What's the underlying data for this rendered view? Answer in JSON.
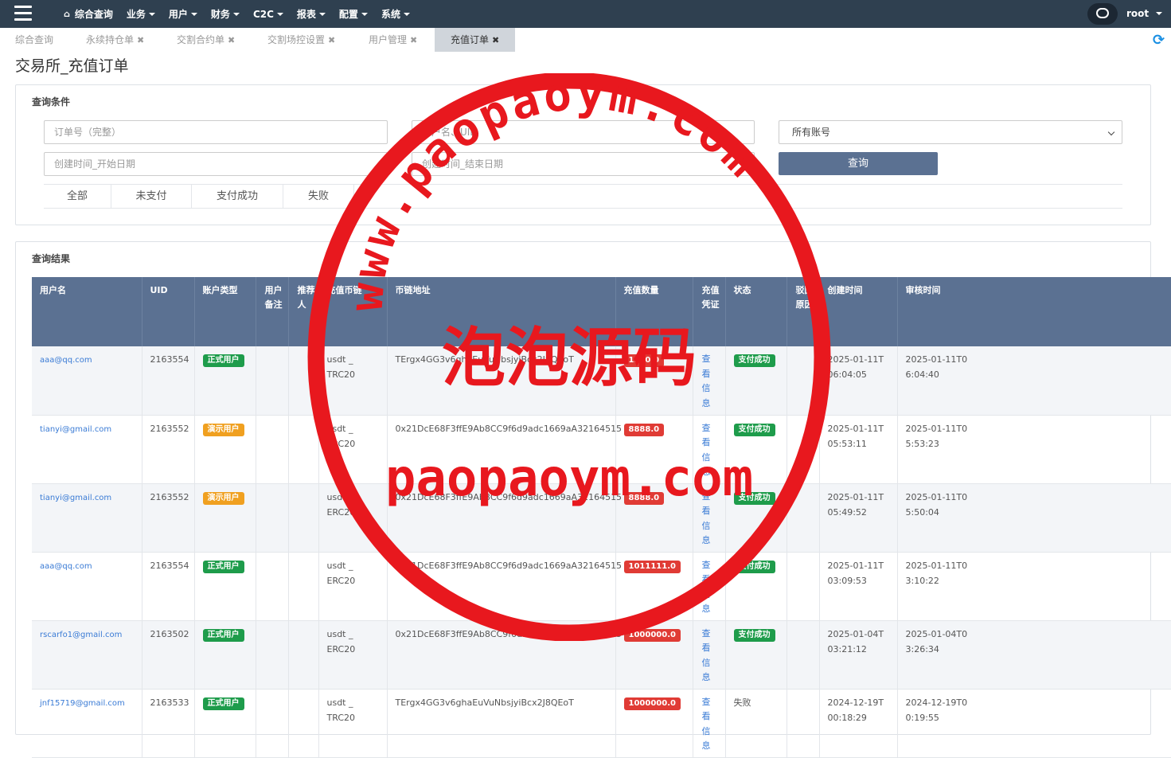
{
  "topbar": {
    "nav": [
      {
        "label": "综合查询",
        "caret": false
      },
      {
        "label": "业务",
        "caret": true
      },
      {
        "label": "用户",
        "caret": true
      },
      {
        "label": "财务",
        "caret": true
      },
      {
        "label": "C2C",
        "caret": true
      },
      {
        "label": "报表",
        "caret": true
      },
      {
        "label": "配置",
        "caret": true
      },
      {
        "label": "系统",
        "caret": true
      }
    ],
    "user": "root"
  },
  "tabs": [
    "综合查询",
    "永续持仓单",
    "交割合约单",
    "交割场控设置",
    "用户管理",
    "充值订单"
  ],
  "page_title": "交易所_充值订单",
  "query": {
    "title": "查询条件",
    "order_placeholder": "订单号（完整）",
    "user_placeholder": "用户名、UID",
    "account_select": "所有账号",
    "start_placeholder": "创建时间_开始日期",
    "end_placeholder": "创建时间_结束日期",
    "button": "查询",
    "filters": [
      "全部",
      "未支付",
      "支付成功",
      "失败"
    ]
  },
  "results": {
    "title": "查询结果",
    "columns": [
      "用户名",
      "UID",
      "账户类型",
      "用户备注",
      "推荐人",
      "充值币链",
      "币链地址",
      "充值数量",
      "充值凭证",
      "状态",
      "驳回原因",
      "创建时间",
      "审核时间"
    ],
    "rows": [
      {
        "user": "aaa@qq.com",
        "uid": "2163554",
        "type": "正式用户",
        "type_color": "green",
        "chain": "usdt _ TRC20",
        "addr": "TErgx4GG3v6ghaEuVuNbsjyiBcx2J8QEoT",
        "amount": "1580.0",
        "voucher": "查看信息",
        "status": "支付成功",
        "status_badge": true,
        "created": "2025-01-11T06:04:05",
        "audited": "2025-01-11T06:04:40"
      },
      {
        "user": "tianyi@gmail.com",
        "uid": "2163552",
        "type": "演示用户",
        "type_color": "orange",
        "chain": "usdt _ ERC20",
        "addr": "0x21DcE68F3ffE9Ab8CC9f6d9adc1669aA32164515",
        "amount": "8888.0",
        "voucher": "查看信息",
        "status": "支付成功",
        "status_badge": true,
        "created": "2025-01-11T05:53:11",
        "audited": "2025-01-11T05:53:23"
      },
      {
        "user": "tianyi@gmail.com",
        "uid": "2163552",
        "type": "演示用户",
        "type_color": "orange",
        "chain": "usdt _ ERC20",
        "addr": "0x21DcE68F3ffE9Ab8CC9f6d9adc1669aA32164515",
        "amount": "8888.0",
        "voucher": "查看信息",
        "status": "支付成功",
        "status_badge": true,
        "created": "2025-01-11T05:49:52",
        "audited": "2025-01-11T05:50:04"
      },
      {
        "user": "aaa@qq.com",
        "uid": "2163554",
        "type": "正式用户",
        "type_color": "green",
        "chain": "usdt _ ERC20",
        "addr": "0x21DcE68F3ffE9Ab8CC9f6d9adc1669aA32164515",
        "amount": "1011111.0",
        "voucher": "查看信息",
        "status": "支付成功",
        "status_badge": true,
        "created": "2025-01-11T03:09:53",
        "audited": "2025-01-11T03:10:22"
      },
      {
        "user": "rscarfo1@gmail.com",
        "uid": "2163502",
        "type": "正式用户",
        "type_color": "green",
        "chain": "usdt _ ERC20",
        "addr": "0x21DcE68F3ffE9Ab8CC9f6d9adc1669aA32164515",
        "amount": "1000000.0",
        "voucher": "查看信息",
        "status": "支付成功",
        "status_badge": true,
        "created": "2025-01-04T03:21:12",
        "audited": "2025-01-04T03:26:34"
      },
      {
        "user": "jnf15719@gmail.com",
        "uid": "2163533",
        "type": "正式用户",
        "type_color": "green",
        "chain": "usdt _ TRC20",
        "addr": "TErgx4GG3v6ghaEuVuNbsjyiBcx2J8QEoT",
        "amount": "1000000.0",
        "voucher": "查看信息",
        "status": "失败",
        "status_badge": false,
        "created": "2024-12-19T00:18:29",
        "audited": "2024-12-19T00:19:55"
      }
    ]
  },
  "watermark": {
    "arc_text": "www.paopaoym.com",
    "center_text": "泡泡源码",
    "bottom_text": "paopaoym.com",
    "color": "#e8181e"
  },
  "colors": {
    "topbar": "#2f4050",
    "header": "#5b7192",
    "success": "#1e9c4b",
    "demo": "#f0a020",
    "amount": "#e03b35",
    "link": "#3a7bd5"
  }
}
